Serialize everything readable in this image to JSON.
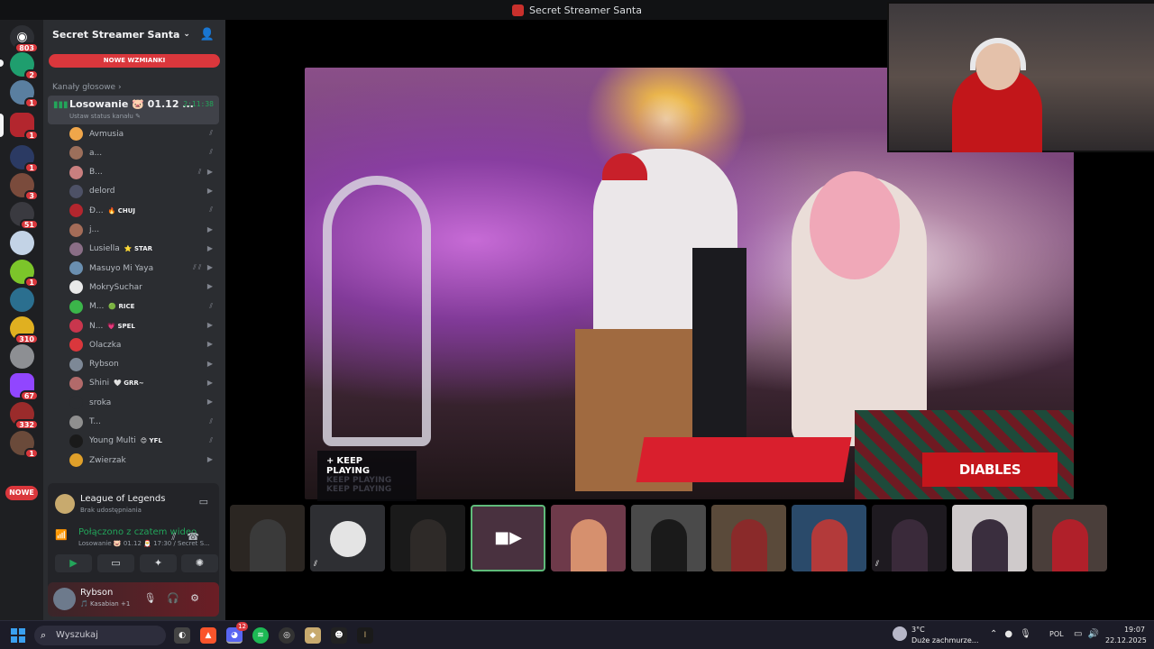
{
  "window": {
    "title": "Secret Streamer Santa"
  },
  "rail": {
    "badges": [
      "803",
      "2",
      "1",
      "1",
      "1",
      "3",
      "51",
      "1",
      "310",
      "67",
      "332",
      "1"
    ],
    "nowe_label": "NOWE"
  },
  "server": {
    "name": "Secret Streamer Santa",
    "mentions_label": "NOWE WZMIANKI",
    "category": "Kanały głosowe"
  },
  "voice_channel": {
    "name": "Losowanie 🐷 01.12 ...",
    "status": "Ustaw status kanału",
    "timer": "2:11:38"
  },
  "members": [
    {
      "name": "Avmusia",
      "tag": "",
      "color": "#f0a64a"
    },
    {
      "name": "a...",
      "tag": "",
      "color": "#9c6f5b"
    },
    {
      "name": "B...",
      "tag": "",
      "color": "#c97f7f"
    },
    {
      "name": "delord",
      "tag": "",
      "color": "#4d5166"
    },
    {
      "name": "Đ...",
      "tag": "🔥 CHUJ",
      "color": "#b3262e"
    },
    {
      "name": "j...",
      "tag": "",
      "color": "#a46c58"
    },
    {
      "name": "Lusiella",
      "tag": "⭐ STAR",
      "color": "#8a6e86"
    },
    {
      "name": "Masuyo Mi Yaya",
      "tag": "",
      "color": "#6a8fb0"
    },
    {
      "name": "MokrySuchar",
      "tag": "",
      "color": "#e9e9e9"
    },
    {
      "name": "M...",
      "tag": "🟢 RICE",
      "color": "#3bb54a"
    },
    {
      "name": "N...",
      "tag": "💗 SPEL",
      "color": "#c9364d"
    },
    {
      "name": "Olaczka",
      "tag": "",
      "color": "#da373c"
    },
    {
      "name": "Rybson",
      "tag": "",
      "color": "#7d8896"
    },
    {
      "name": "Shini",
      "tag": "🤍 GRR~",
      "color": "#b26a6a"
    },
    {
      "name": "sroka",
      "tag": "",
      "color": "#2b2d31"
    },
    {
      "name": "T...",
      "tag": "",
      "color": "#8f8f8f"
    },
    {
      "name": "Young Multi",
      "tag": "😊 YFL",
      "color": "#1a1a1a"
    },
    {
      "name": "Zwierzak",
      "tag": "",
      "color": "#e0a02a"
    }
  ],
  "activity": {
    "game": "League of Legends",
    "sub": "Brak udostępniania"
  },
  "connection": {
    "title": "Połączono z czatem wideo",
    "sub": "Losowanie 🐷 01.12 🎅 17:30 / Secret S..."
  },
  "user": {
    "name": "Rybson",
    "status": "🎵 Kasabian +1"
  },
  "overlays": {
    "keep_playing": "KEEP PLAYING",
    "sponsor": "DIABLES"
  },
  "taskbar": {
    "search_placeholder": "Wyszukaj",
    "weather_temp": "3°C",
    "weather_desc": "Duże zachmurze...",
    "lang": "POL",
    "time": "19:07",
    "date": "22.12.2025",
    "discord_badge": "12"
  }
}
